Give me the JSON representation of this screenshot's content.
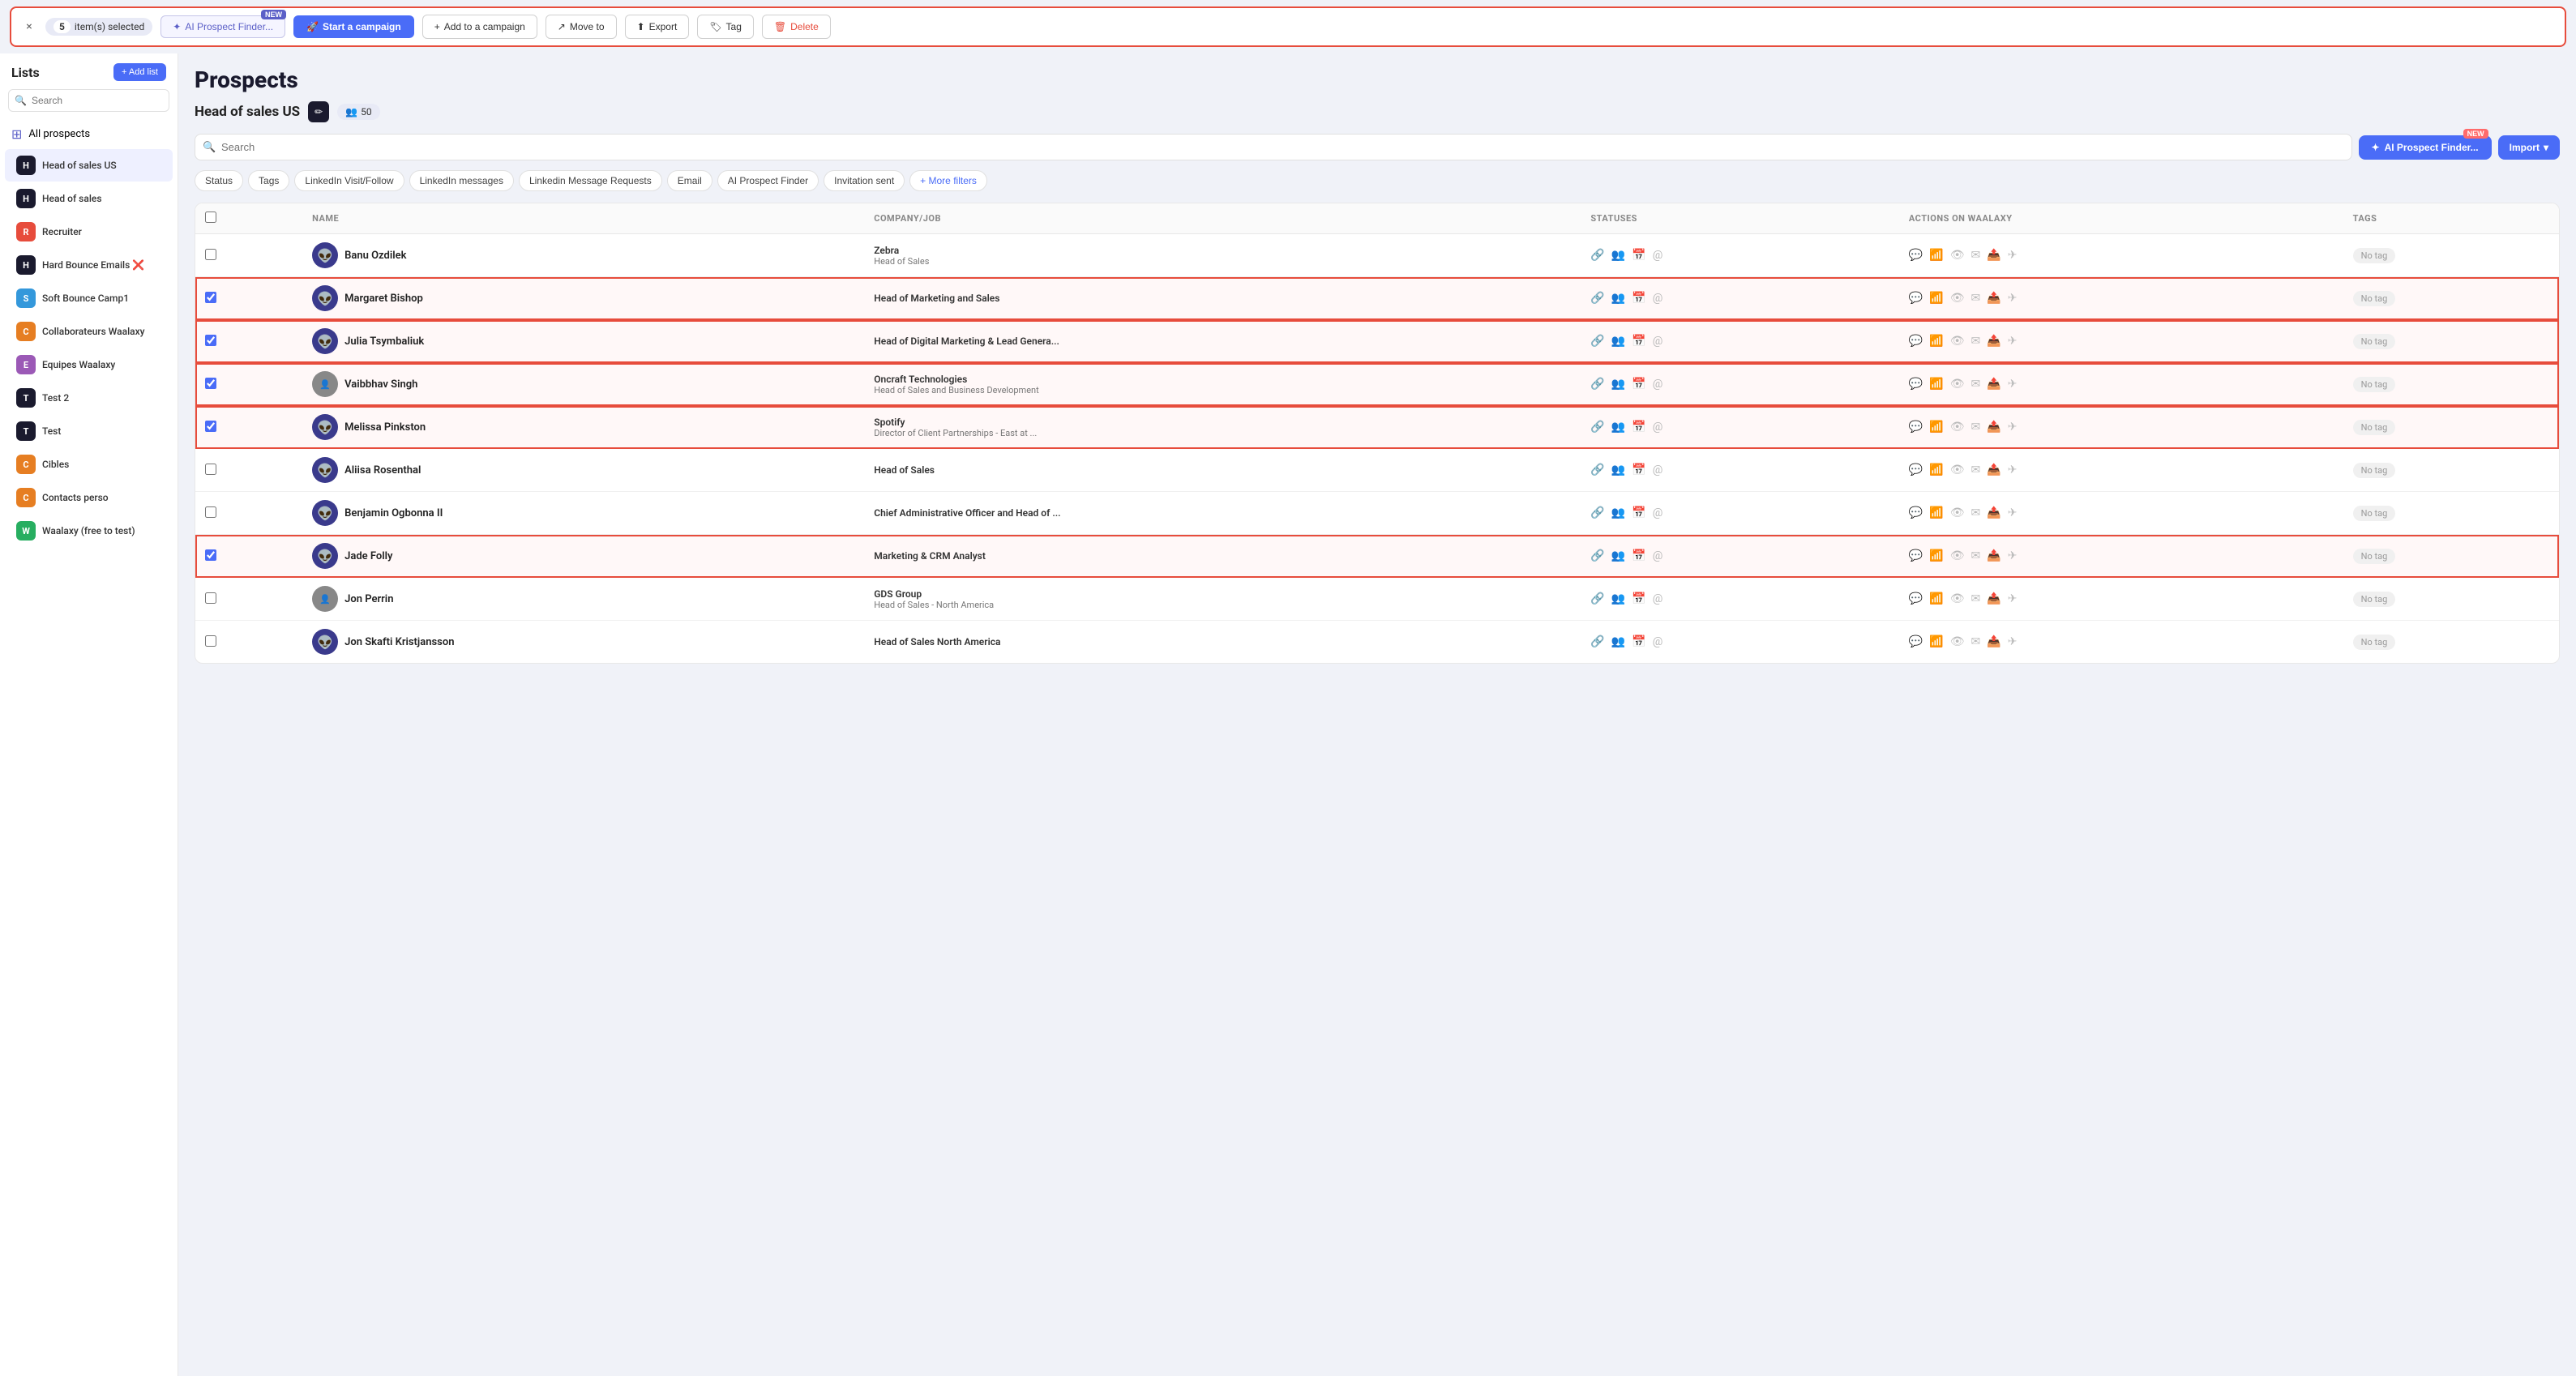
{
  "topbar": {
    "close_label": "×",
    "selected_count": "5",
    "selected_text": "item(s) selected",
    "ai_prospect_label": "AI Prospect Finder...",
    "ai_prospect_new": "NEW",
    "start_campaign_label": "Start a campaign",
    "add_campaign_label": "Add to a campaign",
    "move_to_label": "Move to",
    "export_label": "Export",
    "tag_label": "Tag",
    "delete_label": "Delete"
  },
  "sidebar": {
    "title": "Lists",
    "add_list_label": "+ Add list",
    "search_placeholder": "Search",
    "all_prospects_label": "All prospects",
    "items": [
      {
        "id": "head-of-sales-us",
        "label": "Head of sales US",
        "color": "#1a1a2e",
        "letter": "H",
        "active": true
      },
      {
        "id": "head-of-sales",
        "label": "Head of sales",
        "color": "#1a1a2e",
        "letter": "H",
        "active": false
      },
      {
        "id": "recruiter",
        "label": "Recruiter",
        "color": "#e74c3c",
        "letter": "R",
        "active": false
      },
      {
        "id": "hard-bounce",
        "label": "Hard Bounce Emails ❌",
        "color": "#1a1a2e",
        "letter": "H",
        "active": false
      },
      {
        "id": "soft-bounce",
        "label": "Soft Bounce Camp1",
        "color": "#3498db",
        "letter": "S",
        "active": false
      },
      {
        "id": "collaborateurs",
        "label": "Collaborateurs Waalaxy",
        "color": "#e67e22",
        "letter": "C",
        "active": false
      },
      {
        "id": "equipes",
        "label": "Equipes Waalaxy",
        "color": "#9b59b6",
        "letter": "E",
        "active": false
      },
      {
        "id": "test2",
        "label": "Test 2",
        "color": "#1a1a2e",
        "letter": "T",
        "active": false
      },
      {
        "id": "test",
        "label": "Test",
        "color": "#1a1a2e",
        "letter": "T",
        "active": false
      },
      {
        "id": "cibles",
        "label": "Cibles",
        "color": "#e67e22",
        "letter": "C",
        "active": false
      },
      {
        "id": "contacts-perso",
        "label": "Contacts perso",
        "color": "#e67e22",
        "letter": "C",
        "active": false
      },
      {
        "id": "waalaxy-free",
        "label": "Waalaxy (free to test)",
        "color": "#27ae60",
        "letter": "W",
        "active": false
      }
    ]
  },
  "main": {
    "page_title": "Prospects",
    "list_name": "Head of sales US",
    "count": "50",
    "search_placeholder": "Search",
    "ai_finder_label": "AI Prospect Finder...",
    "ai_finder_new": "NEW",
    "import_label": "Import",
    "filters": [
      "Status",
      "Tags",
      "LinkedIn Visit/Follow",
      "LinkedIn messages",
      "Linkedin Message Requests",
      "Email",
      "AI Prospect Finder",
      "Invitation sent"
    ],
    "more_filters_label": "+ More filters",
    "table": {
      "headers": [
        "",
        "NAME",
        "COMPANY/JOB",
        "STATUSES",
        "ACTIONS ON WAALAXY",
        "TAGS"
      ],
      "rows": [
        {
          "id": 1,
          "name": "Banu Ozdilek",
          "company": "Zebra",
          "job": "Head of Sales",
          "checked": false,
          "selected": false,
          "has_photo": false,
          "tag": "No tag"
        },
        {
          "id": 2,
          "name": "Margaret Bishop",
          "company": "",
          "job": "Head of Marketing and Sales",
          "checked": true,
          "selected": true,
          "has_photo": false,
          "tag": "No tag"
        },
        {
          "id": 3,
          "name": "Julia Tsymbaliuk",
          "company": "",
          "job": "Head of Digital Marketing & Lead Genera...",
          "checked": true,
          "selected": true,
          "has_photo": false,
          "tag": "No tag"
        },
        {
          "id": 4,
          "name": "Vaibbhav Singh",
          "company": "Oncraft Technologies",
          "job": "Head of Sales and Business Development",
          "checked": true,
          "selected": true,
          "has_photo": true,
          "tag": "No tag"
        },
        {
          "id": 5,
          "name": "Melissa Pinkston",
          "company": "Spotify",
          "job": "Director of Client Partnerships - East at ...",
          "checked": true,
          "selected": true,
          "has_photo": false,
          "tag": "No tag"
        },
        {
          "id": 6,
          "name": "Aliisa Rosenthal",
          "company": "",
          "job": "Head of Sales",
          "checked": false,
          "selected": false,
          "has_photo": false,
          "tag": "No tag"
        },
        {
          "id": 7,
          "name": "Benjamin Ogbonna II",
          "company": "",
          "job": "Chief Administrative Officer and Head of ...",
          "checked": false,
          "selected": false,
          "has_photo": false,
          "tag": "No tag"
        },
        {
          "id": 8,
          "name": "Jade Folly",
          "company": "",
          "job": "Marketing & CRM Analyst",
          "checked": true,
          "selected": true,
          "has_photo": false,
          "tag": "No tag"
        },
        {
          "id": 9,
          "name": "Jon Perrin",
          "company": "GDS Group",
          "job": "Head of Sales - North America",
          "checked": false,
          "selected": false,
          "has_photo": true,
          "tag": "No tag"
        },
        {
          "id": 10,
          "name": "Jon Skafti Kristjansson",
          "company": "",
          "job": "Head of Sales North America",
          "checked": false,
          "selected": false,
          "has_photo": false,
          "tag": "No tag"
        }
      ]
    }
  }
}
